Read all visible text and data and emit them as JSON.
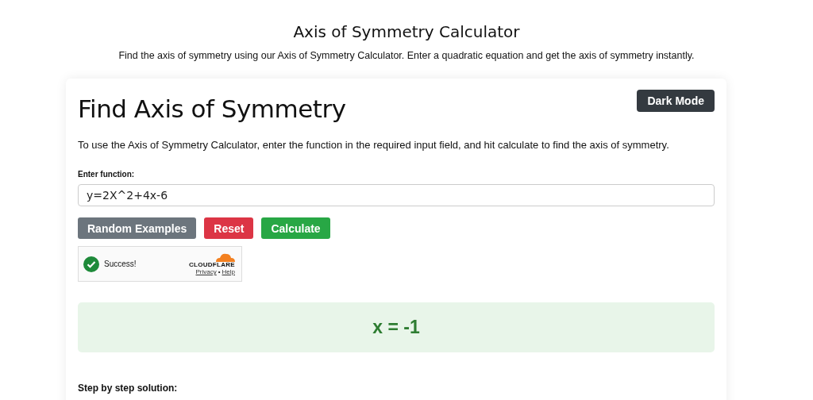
{
  "header": {
    "title": "Axis of Symmetry Calculator",
    "subtitle": "Find the axis of symmetry using our Axis of Symmetry Calculator. Enter a quadratic equation and get the axis of symmetry instantly."
  },
  "card": {
    "title": "Find Axis of Symmetry",
    "theme_button": "Dark Mode",
    "description": "To use the Axis of Symmetry Calculator, enter the function in the required input field, and hit calculate to find the axis of symmetry.",
    "field": {
      "label": "Enter function:",
      "value": "y=2X^2+4x-6"
    },
    "buttons": [
      {
        "label": "Random Examples",
        "kind": "secondary"
      },
      {
        "label": "Reset",
        "kind": "danger"
      },
      {
        "label": "Calculate",
        "kind": "success"
      }
    ],
    "captcha": {
      "status": "Success!",
      "brand": "CLOUDFLARE",
      "links": [
        "Privacy",
        "Help"
      ],
      "separator": "•"
    },
    "result": "x = -1",
    "steps_heading": "Step by step solution:"
  }
}
